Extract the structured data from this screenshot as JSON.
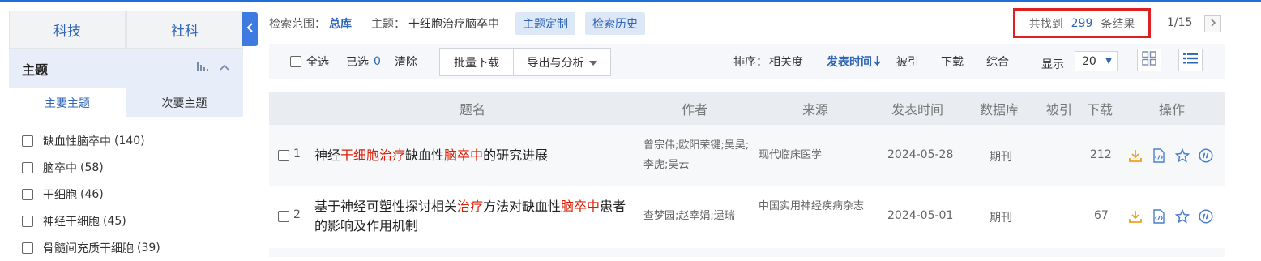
{
  "sidebar": {
    "categories": [
      "科技",
      "社科"
    ],
    "facet_title": "主题",
    "subtabs": [
      "主要主题",
      "次要主题"
    ],
    "items": [
      {
        "label": "缺血性脑卒中",
        "count": "(140)"
      },
      {
        "label": "脑卒中",
        "count": "(58)"
      },
      {
        "label": "干细胞",
        "count": "(46)"
      },
      {
        "label": "神经干细胞",
        "count": "(45)"
      },
      {
        "label": "骨髓间充质干细胞",
        "count": "(39)"
      }
    ]
  },
  "search_info": {
    "scope_label": "检索范围：",
    "scope_value": "总库",
    "topic_label": "主题：",
    "topic_value": "干细胞治疗脑卒中",
    "customize_button": "主题定制",
    "history_button": "检索历史",
    "found_prefix": "共找到",
    "found_count": "299",
    "found_suffix": "条结果",
    "page_indicator": "1/15",
    "next_icon": "chevron-right-icon"
  },
  "toolbar": {
    "select_all": "全选",
    "selected_label": "已选",
    "selected_count": "0",
    "clear": "清除",
    "batch_download": "批量下载",
    "export_analysis": "导出与分析",
    "sort_label": "排序：",
    "sort_options": [
      "相关度",
      "发表时间",
      "被引",
      "下载",
      "综合"
    ],
    "sort_active": "发表时间",
    "display_label": "显示",
    "page_size": "20"
  },
  "table": {
    "headers": [
      "题名",
      "作者",
      "来源",
      "发表时间",
      "数据库",
      "被引",
      "下载",
      "操作"
    ],
    "rows": [
      {
        "num": "1",
        "title_parts": [
          {
            "text": "神经",
            "hl": false
          },
          {
            "text": "干细胞治疗",
            "hl": true
          },
          {
            "text": "缺血性",
            "hl": false
          },
          {
            "text": "脑卒中",
            "hl": true
          },
          {
            "text": "的研究进展",
            "hl": false
          }
        ],
        "authors": "曾宗伟;欧阳荣键;吴昊;李虎;吴云",
        "source": "现代临床医学",
        "date": "2024-05-28",
        "database": "期刊",
        "cited": "",
        "downloads": "212"
      },
      {
        "num": "2",
        "title_parts": [
          {
            "text": "基于神经可塑性探讨相关",
            "hl": false
          },
          {
            "text": "治疗",
            "hl": true
          },
          {
            "text": "方法对缺血性",
            "hl": false
          },
          {
            "text": "脑卒中",
            "hl": true
          },
          {
            "text": "患者的影响及作用机制",
            "hl": false
          }
        ],
        "authors": "查梦园;赵幸娟;逯瑞",
        "source": "中国实用神经疾病杂志",
        "date": "2024-05-01",
        "database": "期刊",
        "cited": "",
        "downloads": "67"
      }
    ],
    "op_icons": [
      "download-icon",
      "html-read-icon",
      "favorite-star-icon",
      "cite-icon"
    ]
  },
  "colors": {
    "accent": "#2f66b8",
    "highlight": "#d81e06",
    "result_box_border": "#e02020",
    "collapse_handle": "#3e7be0"
  }
}
